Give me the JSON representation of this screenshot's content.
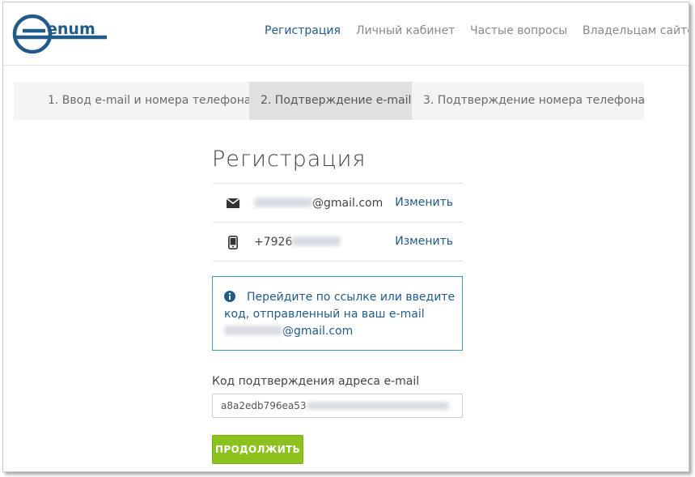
{
  "header": {
    "logo_text": "enum",
    "nav": [
      {
        "label": "Регистрация",
        "active": true
      },
      {
        "label": "Личный кабинет",
        "active": false
      },
      {
        "label": "Частые вопросы",
        "active": false
      },
      {
        "label": "Владельцам сайтов",
        "active": false
      }
    ]
  },
  "steps": [
    {
      "label": "1. Ввод e-mail и номера телефона",
      "active": false
    },
    {
      "label": "2. Подтверждение e-mail",
      "active": true
    },
    {
      "label": "3. Подтверждение номера телефона",
      "active": false
    }
  ],
  "main": {
    "title": "Регистрация",
    "email_row": {
      "value_suffix": "@gmail.com",
      "change_label": "Изменить",
      "icon": "envelope-icon"
    },
    "phone_row": {
      "value_prefix": "+7926",
      "change_label": "Изменить",
      "icon": "mobile-phone-icon"
    },
    "info": {
      "icon": "info-circle-icon",
      "text_prefix": "Перейдите по ссылке или введите код, отправленный на ваш e-mail ",
      "text_suffix": "@gmail.com"
    },
    "code_field": {
      "label": "Код подтверждения адреса e-mail",
      "value_visible": "a8a2edb796ea53"
    },
    "continue_label": "ПРОДОЛЖИТЬ"
  },
  "colors": {
    "accent": "#225b8a",
    "info_border": "#3aa0b6",
    "button_green": "#8cc21d"
  }
}
